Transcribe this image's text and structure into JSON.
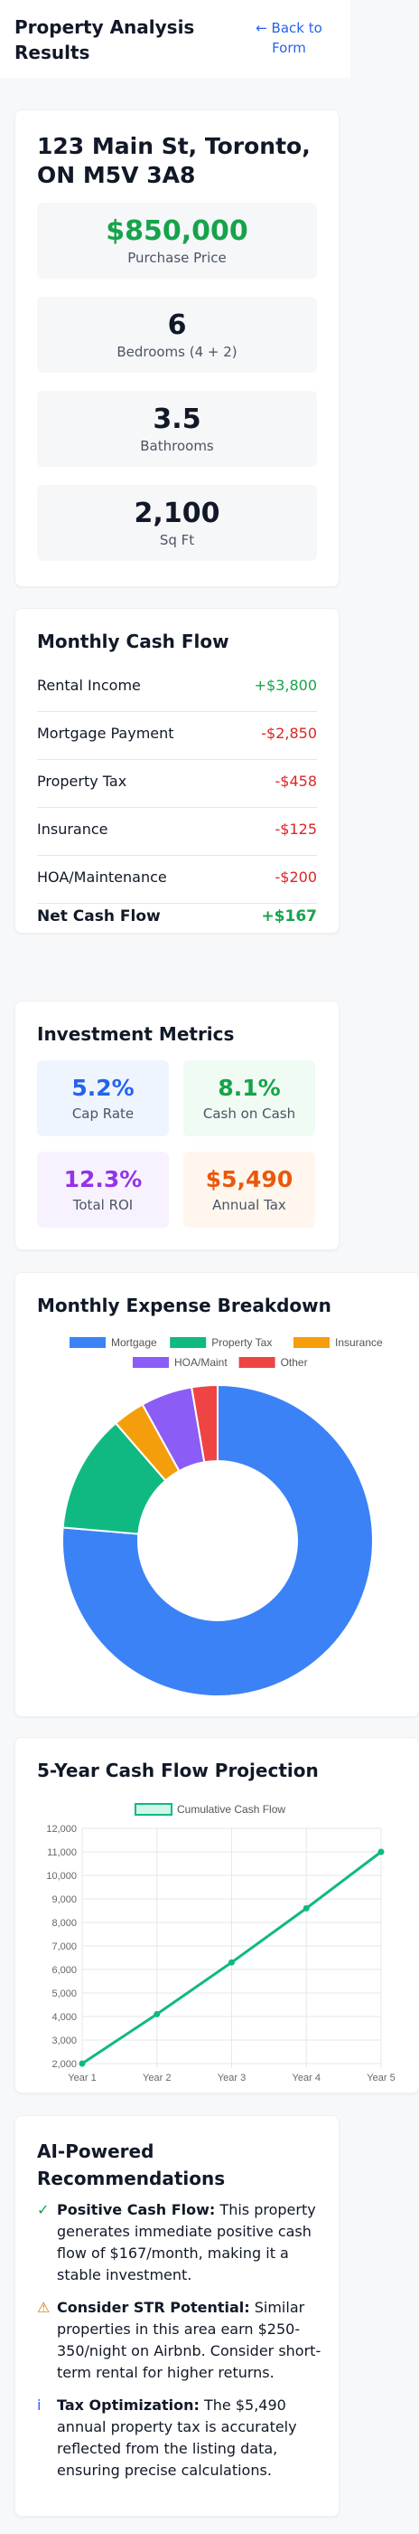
{
  "header": {
    "title": "Property Analysis Results",
    "back_label": "← Back to Form"
  },
  "property": {
    "address": "123 Main St, Toronto, ON M5V 3A8",
    "stats": [
      {
        "value": "$850,000",
        "label": "Purchase Price",
        "color": "#16a34a"
      },
      {
        "value": "6",
        "label": "Bedrooms (4 + 2)",
        "color": "#111827"
      },
      {
        "value": "3.5",
        "label": "Bathrooms",
        "color": "#111827"
      },
      {
        "value": "2,100",
        "label": "Sq Ft",
        "color": "#111827"
      }
    ]
  },
  "cash_flow": {
    "title": "Monthly Cash Flow",
    "rows": [
      {
        "label": "Rental Income",
        "value": "+$3,800"
      },
      {
        "label": "Mortgage Payment",
        "value": "-$2,850"
      },
      {
        "label": "Property Tax",
        "value": "-$458"
      },
      {
        "label": "Insurance",
        "value": "-$125"
      },
      {
        "label": "HOA/Maintenance",
        "value": "-$200"
      }
    ],
    "net_label": "Net Cash Flow",
    "net_value": "+$167"
  },
  "metrics": {
    "title": "Investment Metrics",
    "items": [
      {
        "value": "5.2%",
        "label": "Cap Rate",
        "color": "#2563eb",
        "bg": "#eff5ff"
      },
      {
        "value": "8.1%",
        "label": "Cash on Cash",
        "color": "#16a34a",
        "bg": "#effbf3"
      },
      {
        "value": "12.3%",
        "label": "Total ROI",
        "color": "#9333ea",
        "bg": "#f8f2ff"
      },
      {
        "value": "$5,490",
        "label": "Annual Tax",
        "color": "#ea580c",
        "bg": "#fff6ee"
      }
    ]
  },
  "expense_chart": {
    "title": "Monthly Expense Breakdown"
  },
  "projection_chart": {
    "title": "5-Year Cash Flow Projection"
  },
  "chart_data": [
    {
      "type": "pie",
      "title": "Monthly Expense Breakdown",
      "categories": [
        "Mortgage",
        "Property Tax",
        "Insurance",
        "HOA/Maint",
        "Other"
      ],
      "values": [
        2850,
        458,
        125,
        200,
        100
      ],
      "colors": [
        "#3b82f6",
        "#10b981",
        "#f59e0b",
        "#8b5cf6",
        "#ef4444"
      ],
      "legend": "top"
    },
    {
      "type": "line",
      "title": "5-Year Cash Flow Projection",
      "series": [
        {
          "name": "Cumulative Cash Flow",
          "values": [
            2000,
            4100,
            6300,
            8600,
            11000
          ],
          "color": "#10b981"
        }
      ],
      "categories": [
        "Year 1",
        "Year 2",
        "Year 3",
        "Year 4",
        "Year 5"
      ],
      "y_ticks": [
        "2,000",
        "3,000",
        "4,000",
        "5,000",
        "6,000",
        "7,000",
        "8,000",
        "9,000",
        "10,000",
        "11,000",
        "12,000"
      ],
      "ylim": [
        2000,
        12000
      ],
      "grid": true,
      "legend": "top"
    }
  ],
  "recommendations": {
    "title": "AI-Powered Recommendations",
    "items": [
      {
        "icon": "✓",
        "icon_color": "#16a34a",
        "heading": "Positive Cash Flow:",
        "text": " This property generates immediate positive cash flow of $167/month, making it a stable investment."
      },
      {
        "icon": "⚠",
        "icon_color": "#d97706",
        "heading": "Consider STR Potential:",
        "text": " Similar properties in this area earn $250-350/night on Airbnb. Consider short-term rental for higher returns."
      },
      {
        "icon": "i",
        "icon_color": "#2563eb",
        "heading": "Tax Optimization:",
        "text": " The $5,490 annual property tax is accurately reflected from the listing data, ensuring precise calculations."
      }
    ]
  }
}
